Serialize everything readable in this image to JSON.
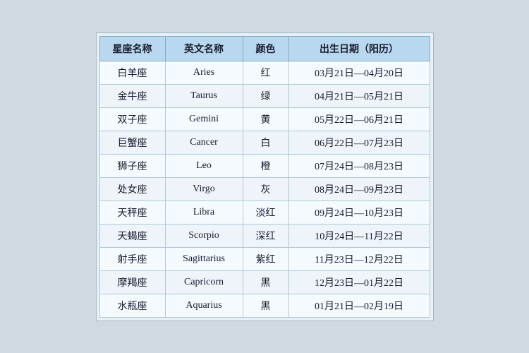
{
  "table": {
    "headers": {
      "chinese_name": "星座名称",
      "english_name": "英文名称",
      "color": "颜色",
      "birth_date": "出生日期（阳历）"
    },
    "rows": [
      {
        "chinese": "白羊座",
        "english": "Aries",
        "color": "红",
        "date": "03月21日—04月20日"
      },
      {
        "chinese": "金牛座",
        "english": "Taurus",
        "color": "绿",
        "date": "04月21日—05月21日"
      },
      {
        "chinese": "双子座",
        "english": "Gemini",
        "color": "黄",
        "date": "05月22日—06月21日"
      },
      {
        "chinese": "巨蟹座",
        "english": "Cancer",
        "color": "白",
        "date": "06月22日—07月23日"
      },
      {
        "chinese": "狮子座",
        "english": "Leo",
        "color": "橙",
        "date": "07月24日—08月23日"
      },
      {
        "chinese": "处女座",
        "english": "Virgo",
        "color": "灰",
        "date": "08月24日—09月23日"
      },
      {
        "chinese": "天秤座",
        "english": "Libra",
        "color": "淡红",
        "date": "09月24日—10月23日"
      },
      {
        "chinese": "天蝎座",
        "english": "Scorpio",
        "color": "深红",
        "date": "10月24日—11月22日"
      },
      {
        "chinese": "射手座",
        "english": "Sagittarius",
        "color": "紫红",
        "date": "11月23日—12月22日"
      },
      {
        "chinese": "摩羯座",
        "english": "Capricorn",
        "color": "黑",
        "date": "12月23日—01月22日"
      },
      {
        "chinese": "水瓶座",
        "english": "Aquarius",
        "color": "黑",
        "date": "01月21日—02月19日"
      }
    ]
  }
}
